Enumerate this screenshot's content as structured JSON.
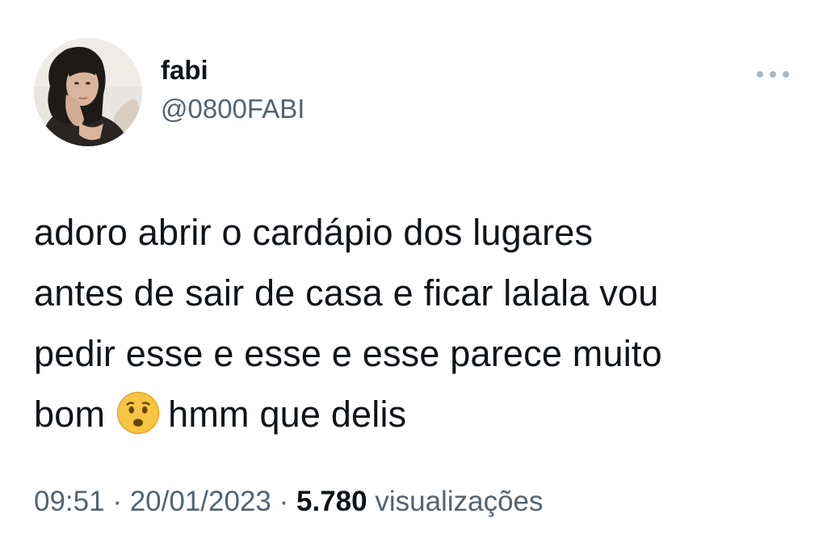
{
  "author": {
    "display_name": "fabi",
    "handle": "@0800FABI",
    "avatar": "profile-photo"
  },
  "menu": {
    "icon": "more-horizontal-icon"
  },
  "tweet": {
    "line1": "adoro abrir o cardápio dos lugares",
    "line2": "antes de sair de casa e ficar lalala vou",
    "line3": "pedir esse e esse e esse parece muito",
    "line4_before": "bom",
    "emoji": "frowning-face-with-open-mouth",
    "line4_after": "hmm que delis"
  },
  "meta": {
    "time": "09:51",
    "separator": "·",
    "date": "20/01/2023",
    "views_count": "5.780",
    "views_label": "visualizações"
  },
  "colors": {
    "text_primary": "#0f1419",
    "text_secondary": "#536471",
    "menu_dots": "#aab8c2",
    "emoji_face": "#f6c543"
  }
}
